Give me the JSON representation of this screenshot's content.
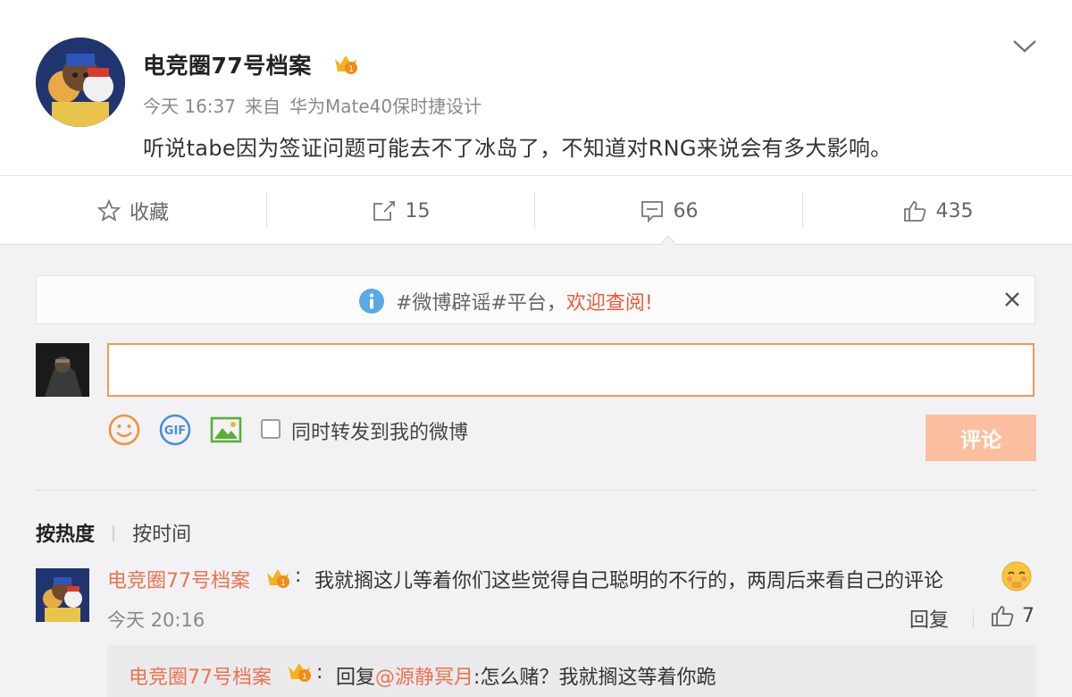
{
  "post": {
    "author": "电竞圈77号档案",
    "time": "今天 16:37",
    "source_prefix": "来自",
    "source": "华为Mate40保时捷设计",
    "text": "听说tabe因为签证问题可能去不了冰岛了，不知道对RNG来说会有多大影响。"
  },
  "actions": {
    "favorite": "收藏",
    "repost_count": "15",
    "comment_count": "66",
    "like_count": "435"
  },
  "notice": {
    "text": "#微博辟谣#平台，",
    "highlight": "欢迎查阅!"
  },
  "composer": {
    "input_value": "",
    "repost_label": "同时转发到我的微博",
    "submit_label": "评论"
  },
  "sort": {
    "active": "按热度",
    "inactive": "按时间"
  },
  "comment": {
    "author": "电竞圈77号档案",
    "text": "我就搁这儿等着你们这些觉得自己聪明的不行的，两周后来看自己的评论",
    "time": "今天 20:16",
    "reply_label": "回复",
    "likes": "7"
  },
  "sub_reply": {
    "author": "电竞圈77号档案",
    "prefix": "回复",
    "mention": "@源静冥月",
    "text": ":怎么赌？我就搁这等着你跪"
  },
  "colors": {
    "name_orange": "#eb7350",
    "notice_red": "#eb5b3a",
    "input_border": "#f39a4d",
    "submit_bg": "#fbbf9f"
  },
  "icons": [
    "chevron-down-icon",
    "star-icon",
    "share-icon",
    "comment-icon",
    "thumb-up-icon",
    "info-icon",
    "close-icon",
    "emoji-icon",
    "gif-icon",
    "image-icon"
  ]
}
